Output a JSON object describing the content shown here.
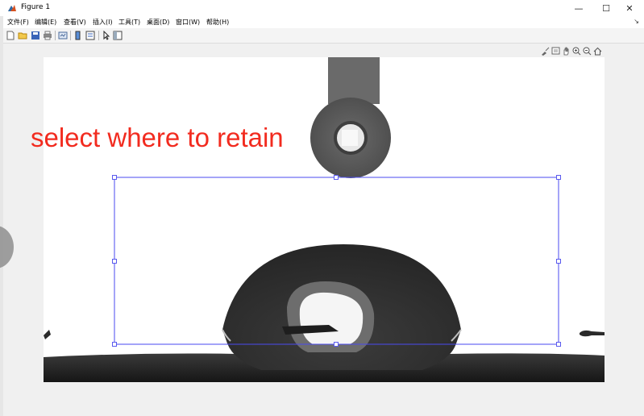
{
  "window": {
    "title": "Figure 1",
    "controls": {
      "minimize": "—",
      "maximize": "☐",
      "close": "✕"
    }
  },
  "menu": {
    "items": [
      "文件(F)",
      "编辑(E)",
      "查看(V)",
      "插入(I)",
      "工具(T)",
      "桌面(D)",
      "窗口(W)",
      "帮助(H)"
    ],
    "overflow": "↘"
  },
  "toolbar": {
    "icons": [
      "new-figure-icon",
      "open-file-icon",
      "save-icon",
      "print-icon",
      "link-plot-icon",
      "insert-colorbar-icon",
      "insert-legend-icon",
      "edit-plot-arrow-icon",
      "property-inspector-icon"
    ]
  },
  "axes_toolbar": {
    "icons": [
      "brush-icon",
      "data-tips-icon",
      "pan-hand-icon",
      "zoom-in-icon",
      "zoom-out-icon",
      "home-icon"
    ]
  },
  "overlay": {
    "instruction_text": "select where to retain",
    "text_color": "#f22b1f"
  },
  "selection_rectangle": {
    "color": "#4a4af0",
    "handle_color": "#5a5aee"
  }
}
